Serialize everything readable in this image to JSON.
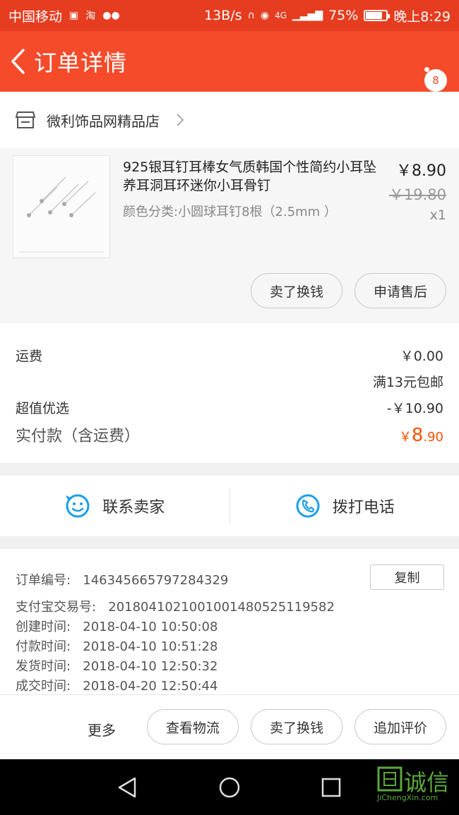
{
  "status_bar": {
    "carrier": "中国移动",
    "speed": "13B/s",
    "network": "4G",
    "battery": "75%",
    "battery_level": 0.75,
    "time": "晚上8:29"
  },
  "header": {
    "title": "订单详情",
    "menu_badge": "8"
  },
  "shop": {
    "name": "微利饰品网精品店"
  },
  "item": {
    "title": "925银耳钉耳棒女气质韩国个性简约小耳坠养耳洞耳环迷你小耳骨钉",
    "sku": "颜色分类:小圆球耳钉8根（2.5mm  ）",
    "price": "￥8.90",
    "original_price": "￥19.80",
    "quantity": "x1",
    "buttons": {
      "sell": "卖了换钱",
      "after_sale": "申请售后"
    }
  },
  "costs": {
    "shipping_label": "运费",
    "shipping_value": "￥0.00",
    "shipping_note": "满13元包邮",
    "discount_label": "超值优选",
    "discount_value": "-￥10.90",
    "paid_label": "实付款（含运费）",
    "paid_currency": "￥",
    "paid_integer": "8",
    "paid_decimal": ".90"
  },
  "contact": {
    "seller": "联系卖家",
    "phone": "拨打电话"
  },
  "order_info": {
    "order_no_label": "订单编号:",
    "order_no": "146345665797284329",
    "copy": "复制",
    "alipay_label": "支付宝交易号:",
    "alipay_no": "2018041021001001480525119582",
    "created_label": "创建时间:",
    "created": "2018-04-10 10:50:08",
    "paid_label": "付款时间:",
    "paid": "2018-04-10 10:51:28",
    "shipped_label": "发货时间:",
    "shipped": "2018-04-10 12:50:32",
    "done_label": "成交时间:",
    "done": "2018-04-20 12:50:44"
  },
  "actions": {
    "more": "更多",
    "logistics": "查看物流",
    "sell": "卖了换钱",
    "review": "追加评价"
  },
  "watermark": {
    "text": "诚信",
    "sub": "JiChengXin.com"
  },
  "colors": {
    "brand": "#f54b2a",
    "price_accent": "#ff5000",
    "contact_icon": "#1aa0e8"
  }
}
